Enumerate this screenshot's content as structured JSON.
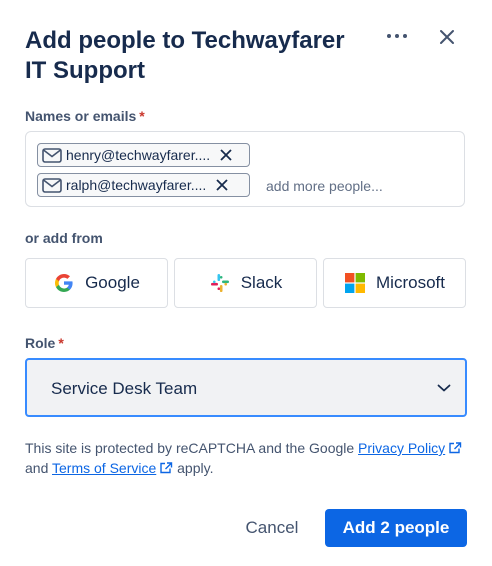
{
  "dialog": {
    "title": "Add people to Techwayfarer IT Support",
    "more_icon": "more-horizontal-icon",
    "close_icon": "close-icon"
  },
  "names": {
    "label": "Names or emails",
    "required_marker": "*",
    "chips": [
      {
        "text": "henry@techwayfarer....",
        "icon": "mail-icon"
      },
      {
        "text": "ralph@techwayfarer....",
        "icon": "mail-icon"
      }
    ],
    "placeholder": "add more people..."
  },
  "add_from": {
    "label": "or add from",
    "providers": [
      {
        "label": "Google",
        "icon": "google-logo-icon"
      },
      {
        "label": "Slack",
        "icon": "slack-logo-icon"
      },
      {
        "label": "Microsoft",
        "icon": "microsoft-logo-icon"
      }
    ]
  },
  "role": {
    "label": "Role",
    "required_marker": "*",
    "selected": "Service Desk Team"
  },
  "legal": {
    "text_before": "This site is protected by reCAPTCHA and the Google ",
    "privacy_link": "Privacy Policy",
    "text_and": " and ",
    "terms_link": "Terms of Service",
    "text_after": " apply."
  },
  "actions": {
    "cancel_label": "Cancel",
    "primary_label": "Add 2 people"
  },
  "colors": {
    "primary": "#0c66e4",
    "required": "#c9372c",
    "focus_border": "#388bff"
  }
}
